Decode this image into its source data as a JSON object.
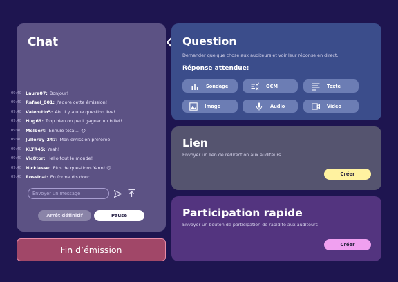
{
  "chat": {
    "title": "Chat",
    "messages": [
      {
        "time": "09:40",
        "author": "Laura07:",
        "text": "Bonjour!"
      },
      {
        "time": "09:40",
        "author": "Rafael_001:",
        "text": "J'adore cette émission!"
      },
      {
        "time": "09:40",
        "author": "Valen-tin5:",
        "text": "Ah, il y a une question live!"
      },
      {
        "time": "09:40",
        "author": "Hug69:",
        "text": "Trop bien on peut gagner un billet!"
      },
      {
        "time": "09:40",
        "author": "Melbert:",
        "text": "Ennuie total... 😞"
      },
      {
        "time": "09:40",
        "author": "Julleroy_247:",
        "text": "Mon émission préférée!"
      },
      {
        "time": "09:40",
        "author": "KLTR45:",
        "text": "Yeah!"
      },
      {
        "time": "09:40",
        "author": "Vic8tor:",
        "text": "Hello tout le monde!"
      },
      {
        "time": "09:40",
        "author": "Nicklasse:",
        "text": "Plus de questions Yann! 😊"
      },
      {
        "time": "09:40",
        "author": "Rossinal:",
        "text": "En forme dis donc!"
      }
    ],
    "input_placeholder": "Envoyer un message",
    "stop_label": "Arrêt définitif",
    "pause_label": "Pause"
  },
  "end_label": "Fin d’émission",
  "question": {
    "title": "Question",
    "desc": "Demander quelque chose aux auditeurs et voir leur réponse en direct.",
    "expected_label": "Réponse attendue:",
    "options": [
      "Sondage",
      "QCM",
      "Texte",
      "Image",
      "Audio",
      "Vidéo"
    ]
  },
  "link": {
    "title": "Lien",
    "desc": "Envoyer un lien de redirection aux auditeurs",
    "create_label": "Créer",
    "button_color": "#fff2a0"
  },
  "rapid": {
    "title": "Participation rapide",
    "desc": "Envoyer un bouton de participation de rapidité aux auditeurs",
    "create_label": "Créer",
    "button_color": "#f0a0f0"
  },
  "colors": {
    "background": "#1e1550",
    "chat_panel": "#5c5284",
    "question_card": "#3b4d8b",
    "link_card": "#55546f",
    "rapid_card": "#53347f",
    "end_button": "#a14768"
  }
}
